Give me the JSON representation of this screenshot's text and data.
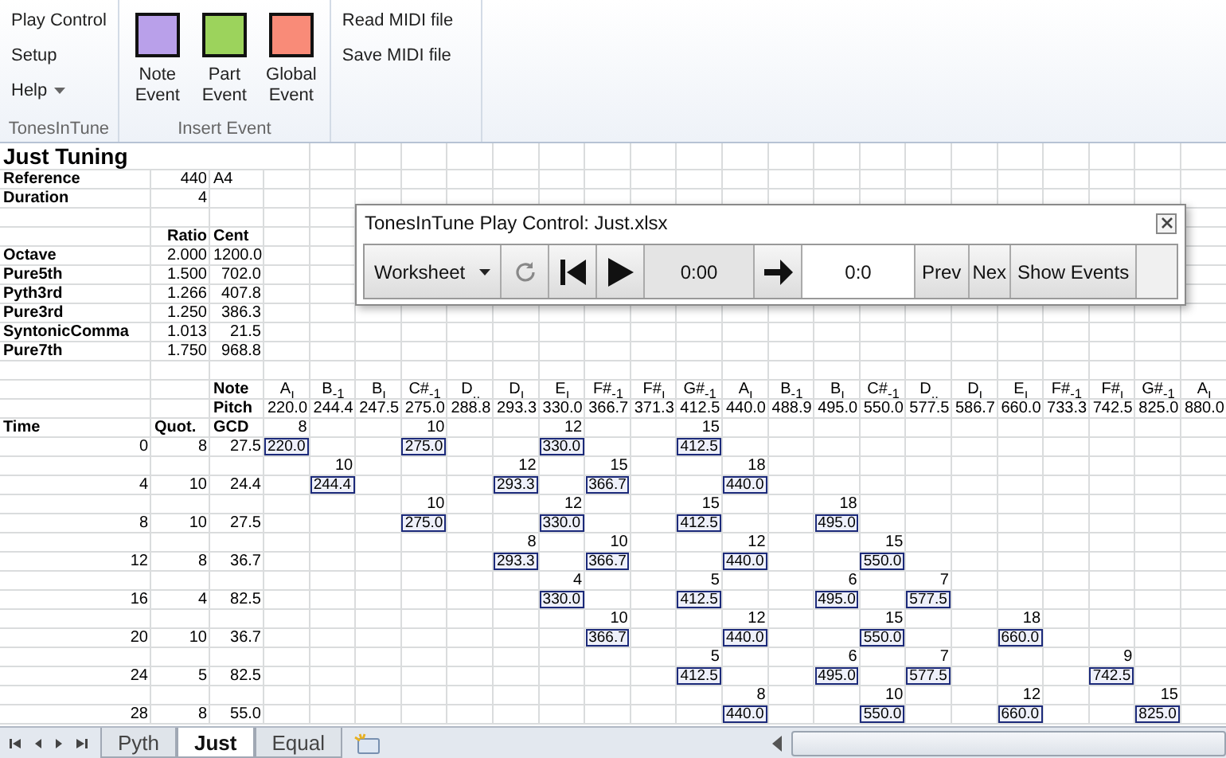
{
  "ribbon": {
    "tonesintune": {
      "label": "TonesInTune",
      "buttons": [
        {
          "label": "Play Control",
          "kind": "button"
        },
        {
          "label": "Setup",
          "kind": "button"
        },
        {
          "label": "Help",
          "kind": "menu"
        }
      ]
    },
    "insert_event": {
      "label": "Insert Event",
      "buttons": [
        {
          "label": "Note Event",
          "color": "#b9a0ea"
        },
        {
          "label": "Part Event",
          "color": "#9cd35c"
        },
        {
          "label": "Global Event",
          "color": "#f98b78"
        }
      ]
    },
    "midi_buttons": [
      "Read MIDI file",
      "Save MIDI file"
    ]
  },
  "sheet": {
    "title": "Just Tuning",
    "settings": [
      {
        "label": "Reference",
        "value": "440",
        "unit": "A4"
      },
      {
        "label": "Duration",
        "value": "4"
      }
    ],
    "ratio_heading": "Ratio",
    "cent_heading": "Cent",
    "intervals": [
      {
        "name": "Octave",
        "ratio": "2.000",
        "cent": "1200.0"
      },
      {
        "name": "Pure5th",
        "ratio": "1.500",
        "cent": "702.0"
      },
      {
        "name": "Pyth3rd",
        "ratio": "1.266",
        "cent": "407.8"
      },
      {
        "name": "Pure3rd",
        "ratio": "1.250",
        "cent": "386.3"
      },
      {
        "name": "SyntonicComma",
        "ratio": "1.013",
        "cent": "21.5"
      },
      {
        "name": "Pure7th",
        "ratio": "1.750",
        "cent": "968.8"
      }
    ],
    "note_heading": "Note",
    "pitch_heading": "Pitch",
    "time_heading": "Time",
    "quot_heading": "Quot.",
    "gcd_heading": "GCD",
    "notes": [
      {
        "name": "A$_{ı}$",
        "pitch": "220.0"
      },
      {
        "name": "B$_{-1}$",
        "pitch": "244.4"
      },
      {
        "name": "B$_{ı}$",
        "pitch": "247.5"
      },
      {
        "name": "C#$_{-1}$",
        "pitch": "275.0"
      },
      {
        "name": "D$_{..}$",
        "pitch": "288.8"
      },
      {
        "name": "D$_{ı}$",
        "pitch": "293.3"
      },
      {
        "name": "E$_{ı}$",
        "pitch": "330.0"
      },
      {
        "name": "F#$_{-1}$",
        "pitch": "366.7"
      },
      {
        "name": "F#$_{ı}$",
        "pitch": "371.3"
      },
      {
        "name": "G#$_{-1}$",
        "pitch": "412.5"
      },
      {
        "name": "A$_{ı}$",
        "pitch": "440.0"
      },
      {
        "name": "B$_{-1}$",
        "pitch": "488.9"
      },
      {
        "name": "B$_{ı}$",
        "pitch": "495.0"
      },
      {
        "name": "C#$_{-1}$",
        "pitch": "550.0"
      },
      {
        "name": "D$_{..}$",
        "pitch": "577.5"
      },
      {
        "name": "D$_{ı}$",
        "pitch": "586.7"
      },
      {
        "name": "E$_{ı}$",
        "pitch": "660.0"
      },
      {
        "name": "F#$_{-1}$",
        "pitch": "733.3"
      },
      {
        "name": "F#$_{ı}$",
        "pitch": "742.5"
      },
      {
        "name": "G#$_{-1}$",
        "pitch": "825.0"
      },
      {
        "name": "A$_{ı}$",
        "pitch": "880.0"
      }
    ],
    "steps": [
      {
        "time": "0",
        "quot": "8",
        "gcd": "27.5",
        "cells": [
          {
            "count": "8",
            "value": "220.0"
          },
          null,
          null,
          {
            "count": "10",
            "value": "275.0"
          },
          null,
          null,
          {
            "count": "12",
            "value": "330.0"
          },
          null,
          null,
          {
            "count": "15",
            "value": "412.5"
          },
          null,
          null,
          null,
          null,
          null,
          null,
          null,
          null,
          null,
          null,
          null
        ]
      },
      {
        "time": "4",
        "quot": "10",
        "gcd": "24.4",
        "cells": [
          null,
          {
            "count": "10",
            "value": "244.4"
          },
          null,
          null,
          null,
          {
            "count": "12",
            "value": "293.3"
          },
          null,
          {
            "count": "15",
            "value": "366.7"
          },
          null,
          null,
          {
            "count": "18",
            "value": "440.0"
          },
          null,
          null,
          null,
          null,
          null,
          null,
          null,
          null,
          null,
          null
        ]
      },
      {
        "time": "8",
        "quot": "10",
        "gcd": "27.5",
        "cells": [
          null,
          null,
          null,
          {
            "count": "10",
            "value": "275.0"
          },
          null,
          null,
          {
            "count": "12",
            "value": "330.0"
          },
          null,
          null,
          {
            "count": "15",
            "value": "412.5"
          },
          null,
          null,
          {
            "count": "18",
            "value": "495.0"
          },
          null,
          null,
          null,
          null,
          null,
          null,
          null,
          null
        ]
      },
      {
        "time": "12",
        "quot": "8",
        "gcd": "36.7",
        "cells": [
          null,
          null,
          null,
          null,
          null,
          {
            "count": "8",
            "value": "293.3"
          },
          null,
          {
            "count": "10",
            "value": "366.7"
          },
          null,
          null,
          {
            "count": "12",
            "value": "440.0"
          },
          null,
          null,
          {
            "count": "15",
            "value": "550.0"
          },
          null,
          null,
          null,
          null,
          null,
          null,
          null
        ]
      },
      {
        "time": "16",
        "quot": "4",
        "gcd": "82.5",
        "cells": [
          null,
          null,
          null,
          null,
          null,
          null,
          {
            "count": "4",
            "value": "330.0"
          },
          null,
          null,
          {
            "count": "5",
            "value": "412.5"
          },
          null,
          null,
          {
            "count": "6",
            "value": "495.0"
          },
          null,
          {
            "count": "7",
            "value": "577.5"
          },
          null,
          null,
          null,
          null,
          null,
          null
        ]
      },
      {
        "time": "20",
        "quot": "10",
        "gcd": "36.7",
        "cells": [
          null,
          null,
          null,
          null,
          null,
          null,
          null,
          {
            "count": "10",
            "value": "366.7"
          },
          null,
          null,
          {
            "count": "12",
            "value": "440.0"
          },
          null,
          null,
          {
            "count": "15",
            "value": "550.0"
          },
          null,
          null,
          {
            "count": "18",
            "value": "660.0"
          },
          null,
          null,
          null,
          null
        ]
      },
      {
        "time": "24",
        "quot": "5",
        "gcd": "82.5",
        "cells": [
          null,
          null,
          null,
          null,
          null,
          null,
          null,
          null,
          null,
          {
            "count": "5",
            "value": "412.5"
          },
          null,
          null,
          {
            "count": "6",
            "value": "495.0"
          },
          null,
          {
            "count": "7",
            "value": "577.5"
          },
          null,
          null,
          null,
          {
            "count": "9",
            "value": "742.5"
          },
          null,
          null
        ]
      },
      {
        "time": "28",
        "quot": "8",
        "gcd": "55.0",
        "cells": [
          null,
          null,
          null,
          null,
          null,
          null,
          null,
          null,
          null,
          null,
          {
            "count": "8",
            "value": "440.0"
          },
          null,
          null,
          {
            "count": "10",
            "value": "550.0"
          },
          null,
          null,
          {
            "count": "12",
            "value": "660.0"
          },
          null,
          null,
          {
            "count": "15",
            "value": "825.0"
          },
          null
        ]
      }
    ]
  },
  "play_control": {
    "title": "TonesInTune Play Control: Just.xlsx",
    "source": "Worksheet",
    "time": "0:00",
    "position": "0:0",
    "buttons": [
      "Prev",
      "Nex",
      "Show Events"
    ]
  },
  "sheet_tabs": [
    {
      "label": "Pyth",
      "selected": false
    },
    {
      "label": "Just",
      "selected": true
    },
    {
      "label": "Equal",
      "selected": false
    }
  ]
}
